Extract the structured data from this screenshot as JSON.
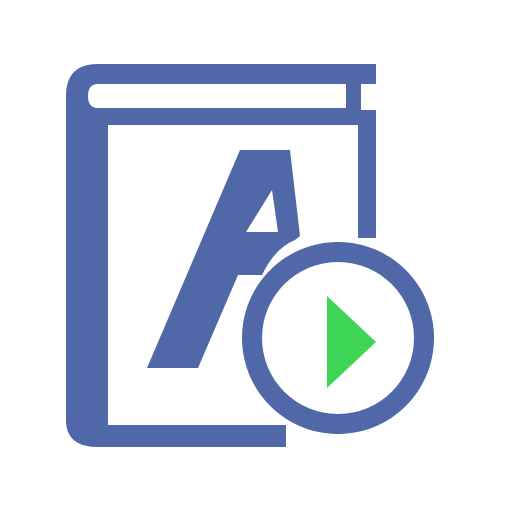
{
  "app_icon": {
    "icon_name": "audio-dictionary-icon",
    "letter": "A",
    "colors": {
      "book": "#5068A8",
      "play_arrow": "#3DD553",
      "background": "#FFFFFF"
    }
  }
}
